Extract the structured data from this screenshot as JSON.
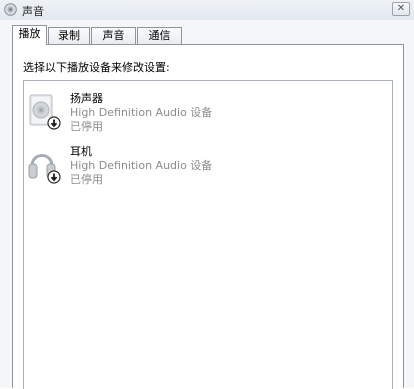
{
  "window": {
    "title": "声音",
    "close_label": "✕"
  },
  "tabs": [
    {
      "label": "播放",
      "active": true
    },
    {
      "label": "录制",
      "active": false
    },
    {
      "label": "声音",
      "active": false
    },
    {
      "label": "通信",
      "active": false
    }
  ],
  "panel": {
    "instruction": "选择以下播放设备来修改设置:"
  },
  "devices": [
    {
      "name": "扬声器",
      "description": "High Definition Audio 设备",
      "status": "已停用",
      "icon": "speaker-icon"
    },
    {
      "name": "耳机",
      "description": "High Definition Audio 设备",
      "status": "已停用",
      "icon": "headphones-icon"
    }
  ]
}
